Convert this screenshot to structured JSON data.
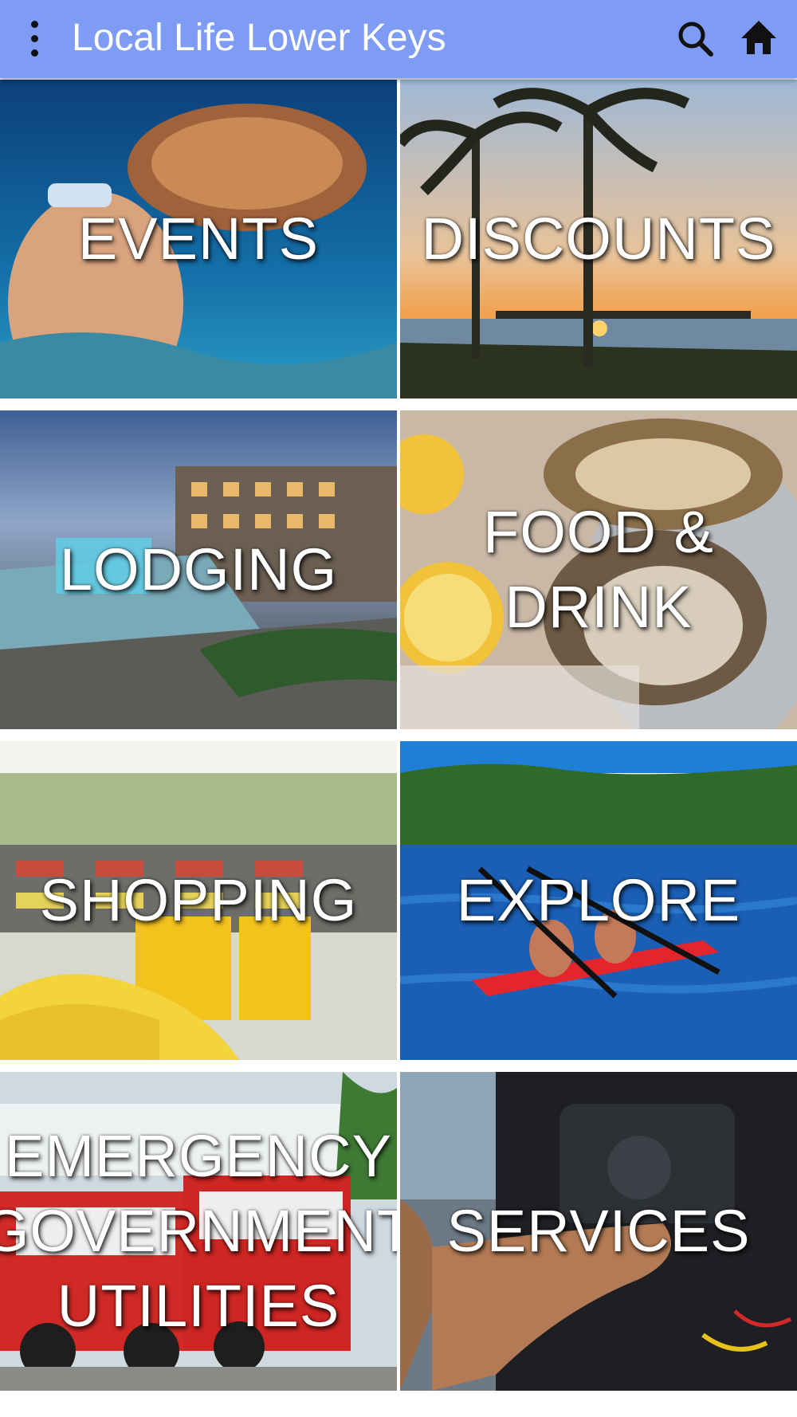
{
  "appbar": {
    "title": "Local Life Lower Keys",
    "menu_icon": "more-vert-icon",
    "search_icon": "search-icon",
    "home_icon": "home-icon",
    "background": "#7f9cf5"
  },
  "tiles": [
    {
      "label": "EVENTS"
    },
    {
      "label": "DISCOUNTS"
    },
    {
      "label": "LODGING"
    },
    {
      "label": "FOOD &\nDRINK"
    },
    {
      "label": "SHOPPING"
    },
    {
      "label": "EXPLORE"
    },
    {
      "label": "EMERGENCY\nGOVERNMENT\nUTILITIES"
    },
    {
      "label": "SERVICES"
    }
  ]
}
